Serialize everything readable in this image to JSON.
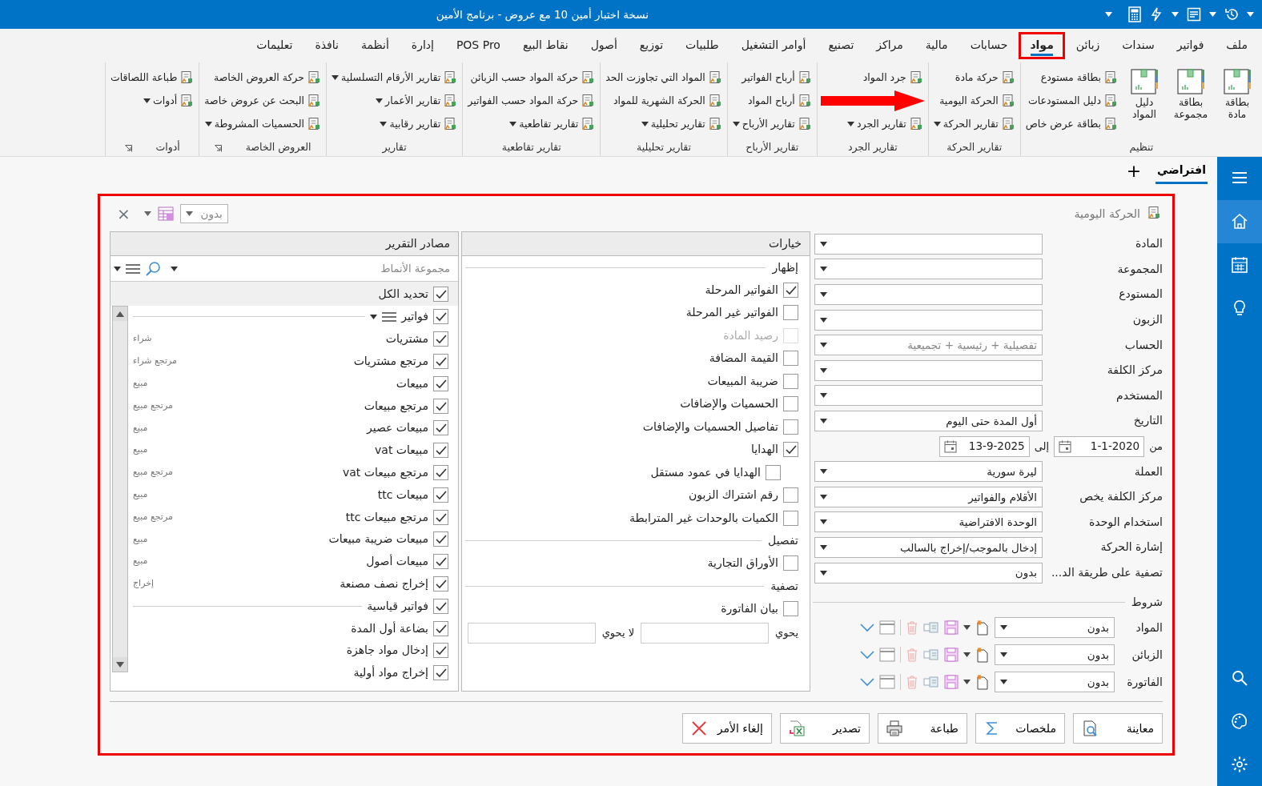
{
  "title_bar": {
    "title": "نسخة اختبار أمين 10 مع عروض - برنامج الأمين"
  },
  "menu_tabs": [
    {
      "label": "ملف",
      "selected": false,
      "highlighted": false
    },
    {
      "label": "فواتير",
      "selected": false,
      "highlighted": false
    },
    {
      "label": "سندات",
      "selected": false,
      "highlighted": false
    },
    {
      "label": "زبائن",
      "selected": false,
      "highlighted": false
    },
    {
      "label": "مواد",
      "selected": true,
      "highlighted": true
    },
    {
      "label": "حسابات",
      "selected": false,
      "highlighted": false
    },
    {
      "label": "مالية",
      "selected": false,
      "highlighted": false
    },
    {
      "label": "مراكز",
      "selected": false,
      "highlighted": false
    },
    {
      "label": "تصنيع",
      "selected": false,
      "highlighted": false
    },
    {
      "label": "أوامر التشغيل",
      "selected": false,
      "highlighted": false
    },
    {
      "label": "طلبيات",
      "selected": false,
      "highlighted": false
    },
    {
      "label": "توزيع",
      "selected": false,
      "highlighted": false
    },
    {
      "label": "أصول",
      "selected": false,
      "highlighted": false
    },
    {
      "label": "نقاط البيع",
      "selected": false,
      "highlighted": false
    },
    {
      "label": "POS Pro",
      "selected": false,
      "highlighted": false
    },
    {
      "label": "إدارة",
      "selected": false,
      "highlighted": false
    },
    {
      "label": "أنظمة",
      "selected": false,
      "highlighted": false
    },
    {
      "label": "نافذة",
      "selected": false,
      "highlighted": false
    },
    {
      "label": "تعليمات",
      "selected": false,
      "highlighted": false
    }
  ],
  "ribbon_groups": [
    {
      "title": "تنظيم",
      "launcher": false,
      "items": [
        {
          "label": "بطاقة مادة",
          "kind": "large",
          "has_dropdown": false
        },
        {
          "label": "بطاقة مجموعة",
          "kind": "large",
          "has_dropdown": false
        },
        {
          "label": "دليل المواد",
          "kind": "large",
          "has_dropdown": false
        },
        {
          "label": "بطاقة مستودع",
          "kind": "small",
          "has_dropdown": false
        },
        {
          "label": "دليل المستودعات",
          "kind": "small",
          "has_dropdown": false
        },
        {
          "label": "بطاقة عرض خاص",
          "kind": "small",
          "has_dropdown": false
        }
      ]
    },
    {
      "title": "تقارير الحركة",
      "launcher": false,
      "items": [
        {
          "label": "حركة مادة",
          "kind": "small",
          "has_dropdown": false
        },
        {
          "label": "الحركة اليومية",
          "kind": "small",
          "has_dropdown": false
        },
        {
          "label": "تقارير الحركة",
          "kind": "small",
          "has_dropdown": true
        }
      ]
    },
    {
      "title": "تقارير الجرد",
      "launcher": false,
      "items": [
        {
          "label": "جرد المواد",
          "kind": "small",
          "has_dropdown": false
        },
        {
          "kind": "arrow"
        },
        {
          "label": "تقارير الجرد",
          "kind": "small",
          "has_dropdown": true
        }
      ]
    },
    {
      "title": "تقارير الأرباح",
      "launcher": false,
      "items": [
        {
          "label": "أرباح الفواتير",
          "kind": "small",
          "has_dropdown": false
        },
        {
          "label": "أرباح المواد",
          "kind": "small",
          "has_dropdown": false
        },
        {
          "label": "تقارير الأرباح",
          "kind": "small",
          "has_dropdown": true
        }
      ]
    },
    {
      "title": "تقارير تحليلية",
      "launcher": false,
      "items": [
        {
          "label": "المواد التي تجاوزت الحد",
          "kind": "small",
          "has_dropdown": false
        },
        {
          "label": "الحركة الشهرية للمواد",
          "kind": "small",
          "has_dropdown": false
        },
        {
          "label": "تقارير تحليلية",
          "kind": "small",
          "has_dropdown": true
        }
      ]
    },
    {
      "title": "تقارير تقاطعية",
      "launcher": false,
      "items": [
        {
          "label": "حركة المواد حسب الزبائن",
          "kind": "small",
          "has_dropdown": false
        },
        {
          "label": "حركة المواد حسب الفواتير",
          "kind": "small",
          "has_dropdown": false
        },
        {
          "label": "تقارير تقاطعية",
          "kind": "small",
          "has_dropdown": true
        }
      ]
    },
    {
      "title": "تقارير",
      "launcher": false,
      "items": [
        {
          "label": "تقارير الأرقام التسلسلية",
          "kind": "small",
          "has_dropdown": true
        },
        {
          "label": "تقارير الأعمار",
          "kind": "small",
          "has_dropdown": true
        },
        {
          "label": "تقارير رقابية",
          "kind": "small",
          "has_dropdown": true
        }
      ]
    },
    {
      "title": "العروض الخاصة",
      "launcher": true,
      "items": [
        {
          "label": "حركة العروض الخاصة",
          "kind": "small",
          "has_dropdown": false
        },
        {
          "label": "البحث عن عروض خاصة",
          "kind": "small",
          "has_dropdown": false
        },
        {
          "label": "الحسميات المشروطة",
          "kind": "small",
          "has_dropdown": true
        }
      ]
    },
    {
      "title": "أدوات",
      "launcher": true,
      "items": [
        {
          "label": "طباعة اللصاقات",
          "kind": "small",
          "has_dropdown": false
        },
        {
          "label": "أدوات",
          "kind": "small",
          "has_dropdown": true
        }
      ]
    }
  ],
  "doc_tabs": [
    {
      "label": "افتراضي",
      "selected": true
    }
  ],
  "add_tab": "+",
  "sidebar": {
    "top": [
      {
        "selected": false
      },
      {
        "selected": true
      },
      {
        "selected": false
      },
      {
        "selected": false
      }
    ],
    "bottom": [
      {
        "selected": false
      },
      {
        "selected": false
      },
      {
        "selected": false
      }
    ]
  },
  "dialog": {
    "title": "الحركة اليومية",
    "highlighted": true,
    "close": "×",
    "toolbar_value": "بدون",
    "form_fields": [
      {
        "kind": "select",
        "label": "المادة"
      },
      {
        "kind": "select",
        "label": "المجموعة"
      },
      {
        "kind": "select",
        "label": "المستودع"
      },
      {
        "kind": "select",
        "label": "الزبون"
      },
      {
        "kind": "select",
        "label": "الحساب",
        "placeholder": "تفصيلية + رئيسية + تجميعية"
      },
      {
        "kind": "select",
        "label": "مركز الكلفة"
      },
      {
        "kind": "select",
        "label": "المستخدم"
      },
      {
        "kind": "select",
        "label": "التاريخ",
        "value": "أول المدة حتى اليوم"
      },
      {
        "kind": "date_range",
        "label": "من",
        "from": "1-1-2020",
        "to_label": "إلى",
        "to": "13-9-2025"
      },
      {
        "kind": "select",
        "label": "العملة",
        "value": "ليرة سورية"
      },
      {
        "kind": "select",
        "label": "مركز الكلفة يخص",
        "value": "الأقلام والفواتير"
      },
      {
        "kind": "select",
        "label": "استخدام الوحدة",
        "value": "الوحدة الافتراضية"
      },
      {
        "kind": "select",
        "label": "إشارة الحركة",
        "value": "إدخال بالموجب/إخراج بالسالب"
      },
      {
        "kind": "select",
        "label": "تصفية على طريقة الد...",
        "value": "بدون"
      }
    ],
    "conditions": {
      "title": "شروط",
      "rows": [
        {
          "label": "المواد",
          "value": "بدون"
        },
        {
          "label": "الزبائن",
          "value": "بدون"
        },
        {
          "label": "الفاتورة",
          "value": "بدون"
        }
      ]
    },
    "options": {
      "title": "خيارات",
      "sections": [
        {
          "title": "إظهار",
          "items": [
            {
              "label": "الفواتير المرحلة",
              "checked": true,
              "disabled": false
            },
            {
              "label": "الفواتير غير المرحلة",
              "checked": false,
              "disabled": false
            },
            {
              "label": "رصيد المادة",
              "checked": false,
              "disabled": true
            },
            {
              "label": "القيمة المضافة",
              "checked": false,
              "disabled": false
            },
            {
              "label": "ضريبة المبيعات",
              "checked": false,
              "disabled": false
            },
            {
              "label": "الحسميات والإضافات",
              "checked": false,
              "disabled": false
            },
            {
              "label": "تفاصيل الحسميات والإضافات",
              "checked": false,
              "disabled": false
            },
            {
              "label": "الهدايا",
              "checked": true,
              "disabled": false,
              "children": [
                {
                  "label": "الهدايا في عمود مستقل",
                  "checked": false,
                  "disabled": false
                }
              ]
            },
            {
              "label": "رقم اشتراك الزبون",
              "checked": false,
              "disabled": false
            },
            {
              "label": "الكميات بالوحدات غير المترابطة",
              "checked": false,
              "disabled": false
            }
          ]
        },
        {
          "title": "تفصيل",
          "items": [
            {
              "label": "الأوراق التجارية",
              "checked": false,
              "disabled": false
            }
          ]
        },
        {
          "title": "تصفية",
          "items": [
            {
              "label": "بيان الفاتورة",
              "checked": false,
              "disabled": false
            }
          ],
          "contains_label": "يحوي",
          "not_contains_label": "لا يحوي"
        }
      ]
    },
    "sources": {
      "title": "مصادر التقرير",
      "search_placeholder": "مجموعة الأنماط",
      "select_all": {
        "label": "تحديد الكل",
        "checked": true
      },
      "groups": [
        {
          "label": "فواتير",
          "checked": true,
          "has_menu": true,
          "items": [
            {
              "label": "مشتريات",
              "checked": true,
              "note": "شراء"
            },
            {
              "label": "مرتجع مشتريات",
              "checked": true,
              "note": "مرتجع شراء"
            },
            {
              "label": "مبيعات",
              "checked": true,
              "note": "مبيع"
            },
            {
              "label": "مرتجع مبيعات",
              "checked": true,
              "note": "مرتجع مبيع"
            },
            {
              "label": "مبيعات عصير",
              "checked": true,
              "note": "مبيع"
            },
            {
              "label": "مبيعات vat",
              "checked": true,
              "note": "مبيع"
            },
            {
              "label": "مرتجع مبيعات vat",
              "checked": true,
              "note": "مرتجع مبيع"
            },
            {
              "label": "مبيعات ttc",
              "checked": true,
              "note": "مبيع"
            },
            {
              "label": "مرتجع مبيعات ttc",
              "checked": true,
              "note": "مرتجع مبيع"
            },
            {
              "label": "مبيعات ضريبة مبيعات",
              "checked": true,
              "note": "مبيع"
            },
            {
              "label": "مبيعات أصول",
              "checked": true,
              "note": "مبيع"
            },
            {
              "label": "إخراج نصف مصنعة",
              "checked": true,
              "note": "إخراج"
            }
          ]
        },
        {
          "label": "فواتير قياسية",
          "checked": true,
          "has_menu": false,
          "items": [
            {
              "label": "بضاعة أول المدة",
              "checked": true
            },
            {
              "label": "إدخال مواد جاهزة",
              "checked": true
            },
            {
              "label": "إخراج مواد أولية",
              "checked": true
            }
          ]
        }
      ]
    },
    "buttons": [
      {
        "label": "معاينة",
        "kind": "preview"
      },
      {
        "label": "ملخصات",
        "kind": "summary"
      },
      {
        "label": "طباعة",
        "kind": "print"
      },
      {
        "label": "تصدير",
        "kind": "export"
      },
      {
        "label": "إلغاء الأمر",
        "kind": "cancel"
      }
    ]
  }
}
